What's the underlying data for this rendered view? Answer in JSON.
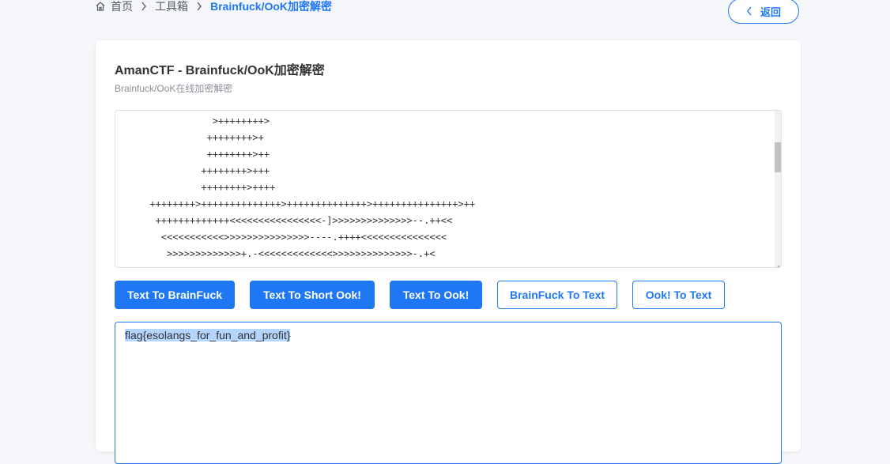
{
  "breadcrumb": {
    "home": "首页",
    "toolbox": "工具箱",
    "current": "Brainfuck/OoK加密解密"
  },
  "back_label": "返回",
  "card": {
    "title": "AmanCTF - Brainfuck/OoK加密解密",
    "subtitle": "Brainfuck/OoK在线加密解密"
  },
  "code_lines": [
    "                 >++++++++>",
    "                ++++++++>+",
    "                ++++++++>++",
    "               ++++++++>+++",
    "               ++++++++>++++",
    "      ++++++++>++++++++++++++>++++++++++++++>+++++++++++++++>++",
    "       +++++++++++++<<<<<<<<<<<<<<<<-]>>>>>>>>>>>>>>--.++<<",
    "        <<<<<<<<<<<>>>>>>>>>>>>>>>----.++++<<<<<<<<<<<<<<<",
    "         >>>>>>>>>>>>>+.-<<<<<<<<<<<<<>>>>>>>>>>>>>>-.+<"
  ],
  "buttons": {
    "text_to_bf": "Text To BrainFuck",
    "text_to_short_ook": "Text To Short Ook!",
    "text_to_ook": "Text To Ook!",
    "bf_to_text": "BrainFuck To Text",
    "ook_to_text": "Ook! To Text"
  },
  "output": "flag{esolangs_for_fun_and_profit}",
  "colors": {
    "accent": "#1f77f4",
    "selection": "#b4d5fe"
  }
}
